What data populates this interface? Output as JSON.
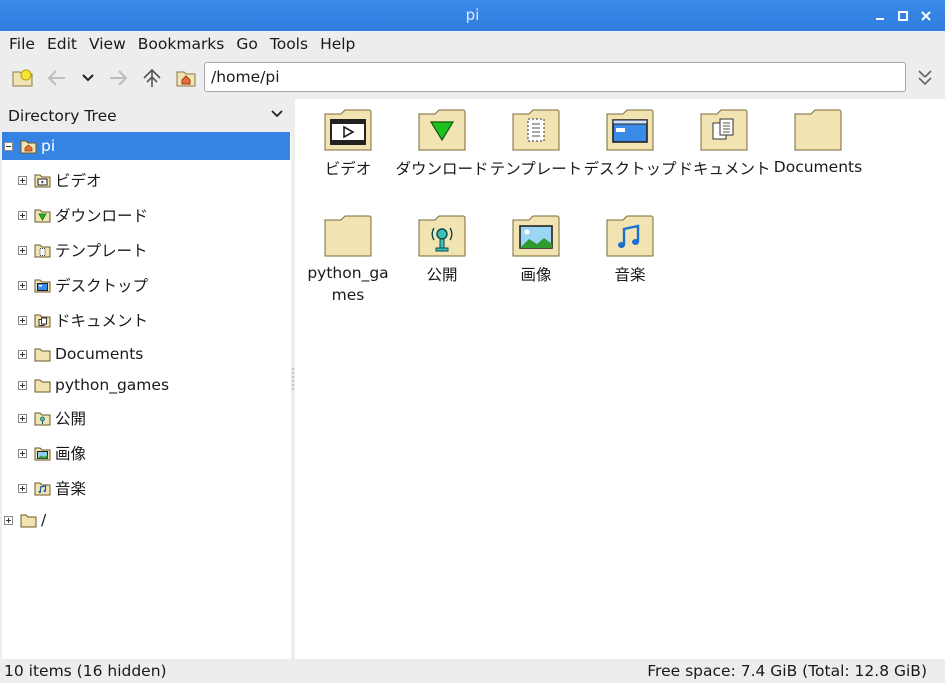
{
  "window": {
    "title": "pi"
  },
  "menu": [
    "File",
    "Edit",
    "View",
    "Bookmarks",
    "Go",
    "Tools",
    "Help"
  ],
  "toolbar": {
    "path_value": "/home/pi",
    "icons": [
      "new-tab-icon",
      "back-icon",
      "history-dropdown-icon",
      "forward-icon",
      "parent-folder-icon",
      "home-icon",
      "go-icon"
    ]
  },
  "sidebar": {
    "header": "Directory Tree",
    "root": {
      "label": "pi",
      "icon": "home-folder-icon"
    },
    "children": [
      {
        "label": "ビデオ",
        "icon": "video-folder-icon"
      },
      {
        "label": "ダウンロード",
        "icon": "download-folder-icon"
      },
      {
        "label": "テンプレート",
        "icon": "templates-folder-icon"
      },
      {
        "label": "デスクトップ",
        "icon": "desktop-folder-icon"
      },
      {
        "label": "ドキュメント",
        "icon": "documents-folder-icon"
      },
      {
        "label": "Documents",
        "icon": "folder-icon"
      },
      {
        "label": "python_games",
        "icon": "folder-icon"
      },
      {
        "label": "公開",
        "icon": "public-folder-icon"
      },
      {
        "label": "画像",
        "icon": "pictures-folder-icon"
      },
      {
        "label": "音楽",
        "icon": "music-folder-icon"
      }
    ],
    "fs_root": {
      "label": "/",
      "icon": "folder-icon"
    }
  },
  "files": [
    {
      "name": "ビデオ",
      "icon": "video-folder-icon"
    },
    {
      "name": "ダウンロード",
      "icon": "download-folder-icon"
    },
    {
      "name": "テンプレート",
      "icon": "templates-folder-icon"
    },
    {
      "name": "デスクトップ",
      "icon": "desktop-folder-icon"
    },
    {
      "name": "ドキュメント",
      "icon": "documents-folder-icon"
    },
    {
      "name": "Documents",
      "icon": "folder-icon"
    },
    {
      "name": "python_games",
      "icon": "folder-icon"
    },
    {
      "name": "公開",
      "icon": "public-folder-icon"
    },
    {
      "name": "画像",
      "icon": "pictures-folder-icon"
    },
    {
      "name": "音楽",
      "icon": "music-folder-icon"
    }
  ],
  "status": {
    "items": "10 items (16 hidden)",
    "free_space": "Free space: 7.4 GiB (Total: 12.8 GiB)"
  },
  "colors": {
    "titlebar": "#3584e4",
    "selection": "#3584e4",
    "folder": "#f2e3b3"
  }
}
